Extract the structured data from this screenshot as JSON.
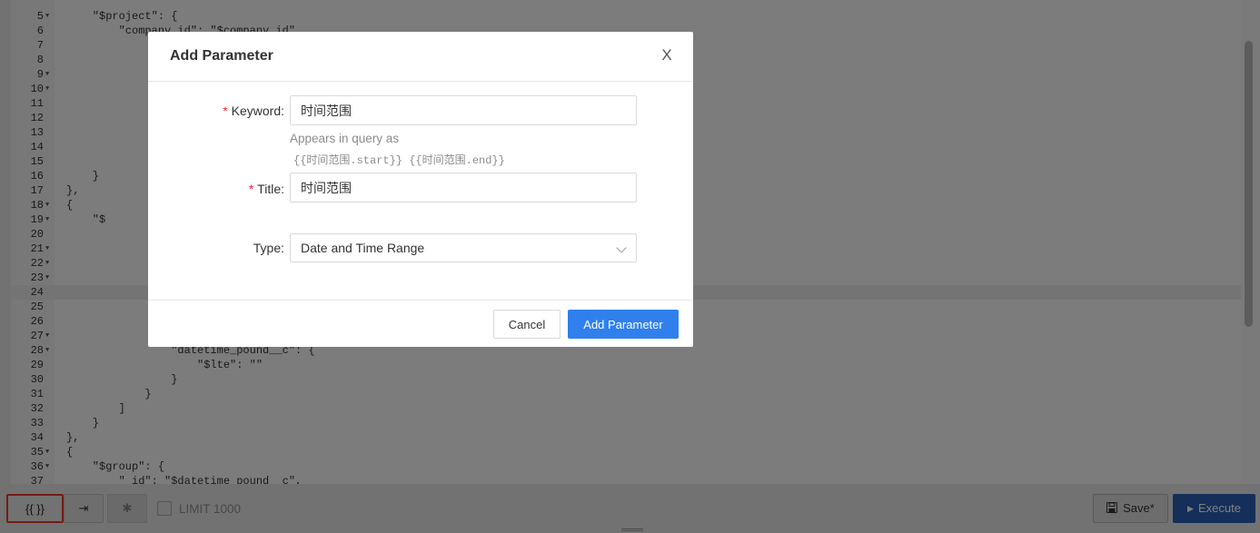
{
  "editor": {
    "lines": [
      {
        "n": "5",
        "fold": true,
        "text": "    \"$project\": {"
      },
      {
        "n": "6",
        "fold": false,
        "text": "        \"company_id\": \"$company_id\","
      },
      {
        "n": "7",
        "fold": false,
        "text": ""
      },
      {
        "n": "8",
        "fold": false,
        "text": ""
      },
      {
        "n": "9",
        "fold": true,
        "text": ""
      },
      {
        "n": "10",
        "fold": true,
        "text": ""
      },
      {
        "n": "11",
        "fold": false,
        "text": ""
      },
      {
        "n": "12",
        "fold": false,
        "text": ""
      },
      {
        "n": "13",
        "fold": false,
        "text": ""
      },
      {
        "n": "14",
        "fold": false,
        "text": ""
      },
      {
        "n": "15",
        "fold": false,
        "text": ""
      },
      {
        "n": "16",
        "fold": false,
        "text": "    }"
      },
      {
        "n": "17",
        "fold": false,
        "text": "},"
      },
      {
        "n": "18",
        "fold": true,
        "text": "{"
      },
      {
        "n": "19",
        "fold": true,
        "text": "    \"$"
      },
      {
        "n": "20",
        "fold": false,
        "text": ""
      },
      {
        "n": "21",
        "fold": true,
        "text": ""
      },
      {
        "n": "22",
        "fold": true,
        "text": ""
      },
      {
        "n": "23",
        "fold": true,
        "text": ""
      },
      {
        "n": "24",
        "fold": false,
        "text": ""
      },
      {
        "n": "25",
        "fold": false,
        "text": ""
      },
      {
        "n": "26",
        "fold": false,
        "text": ""
      },
      {
        "n": "27",
        "fold": true,
        "text": ""
      },
      {
        "n": "28",
        "fold": true,
        "text": "                \"datetime_pound__c\": {"
      },
      {
        "n": "29",
        "fold": false,
        "text": "                    \"$lte\": \"\""
      },
      {
        "n": "30",
        "fold": false,
        "text": "                }"
      },
      {
        "n": "31",
        "fold": false,
        "text": "            }"
      },
      {
        "n": "32",
        "fold": false,
        "text": "        ]"
      },
      {
        "n": "33",
        "fold": false,
        "text": "    }"
      },
      {
        "n": "34",
        "fold": false,
        "text": "},"
      },
      {
        "n": "35",
        "fold": true,
        "text": "{"
      },
      {
        "n": "36",
        "fold": true,
        "text": "    \"$group\": {"
      },
      {
        "n": "37",
        "fold": false,
        "text": "        \"_id\": \"$datetime_pound__c\","
      }
    ],
    "active_line": "24"
  },
  "modal": {
    "title": "Add Parameter",
    "close_label": "X",
    "keyword_label": "Keyword",
    "keyword_value": "时间范围",
    "help_text": "Appears in query as",
    "help_code": "{{时间范围.start}} {{时间范围.end}}",
    "title_label": "Title",
    "title_value": "时间范围",
    "type_label": "Type",
    "type_value": "Date and Time Range",
    "cancel_label": "Cancel",
    "submit_label": "Add Parameter",
    "required_mark": "*",
    "colon": ":"
  },
  "toolbar": {
    "params_label": "{{ }}",
    "indent_label": "⇥",
    "magic_label": "✱",
    "limit_label": "LIMIT 1000",
    "save_label": "Save*",
    "execute_label": "Execute"
  },
  "colors": {
    "primary": "#2f80ed",
    "execute": "#2a5eb5",
    "highlight_border": "#e8382a",
    "required": "#f5222d"
  }
}
